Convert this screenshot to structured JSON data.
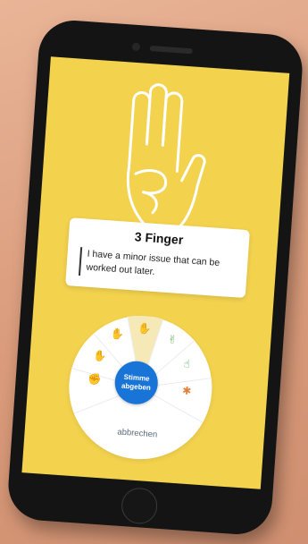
{
  "card": {
    "title": "3 Finger",
    "description": "I have a minor issue that can be worked out later."
  },
  "wheel": {
    "center_label_line1": "Stimme",
    "center_label_line2": "abgeben",
    "cancel_label": "abbrechen",
    "selected": "3-finger",
    "icons": [
      {
        "name": "4-finger-icon",
        "color": "#e3813a"
      },
      {
        "name": "3-finger-icon",
        "color": "#d9b43a"
      },
      {
        "name": "2-finger-icon",
        "color": "#6fb56a"
      },
      {
        "name": "1-finger-icon",
        "color": "#3aa54a"
      },
      {
        "name": "hands-up-icon",
        "color": "#e3813a"
      },
      {
        "name": "fist-icon",
        "color": "#d9534f"
      },
      {
        "name": "5-finger-icon",
        "color": "#d9534f"
      }
    ]
  },
  "colors": {
    "screen_background": "#f3d24e",
    "accent_blue": "#1874d6",
    "selected_segment": "#f6e9b8"
  }
}
